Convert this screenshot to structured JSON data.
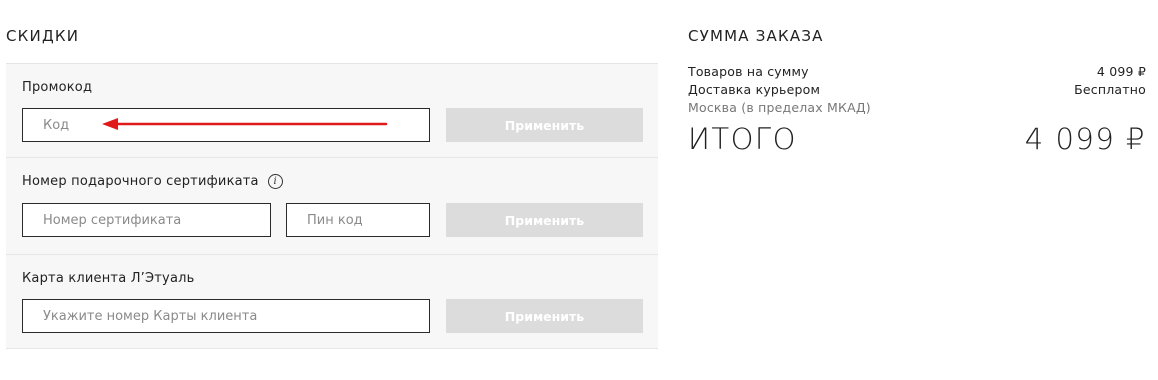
{
  "discounts": {
    "title": "СКИДКИ",
    "promo": {
      "label": "Промокод",
      "input_placeholder": "Код",
      "apply_label": "Применить"
    },
    "gift_certificate": {
      "label": "Номер подарочного сертификата",
      "info_icon": "info-icon",
      "cert_placeholder": "Номер сертификата",
      "pin_placeholder": "Пин код",
      "apply_label": "Применить"
    },
    "client_card": {
      "label": "Карта клиента Л’Этуаль",
      "input_placeholder": "Укажите номер Карты клиента",
      "apply_label": "Применить"
    }
  },
  "summary": {
    "title": "СУММА ЗАКАЗА",
    "goods_label": "Товаров на сумму",
    "goods_value": "4 099 ₽",
    "delivery_label": "Доставка курьером",
    "delivery_value": "Бесплатно",
    "delivery_note": "Москва (в пределах МКАД)",
    "total_label": "ИТОГО",
    "total_value": "4 099 ₽"
  },
  "colors": {
    "panel_bg": "#f7f7f7",
    "button_disabled": "#dcdcdc",
    "arrow": "#e01a1a"
  }
}
